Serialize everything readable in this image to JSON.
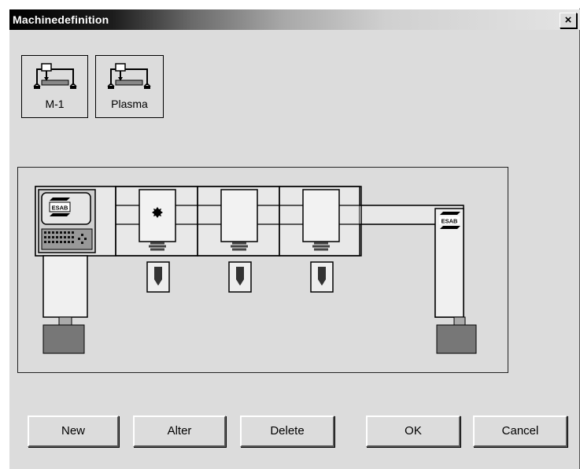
{
  "window": {
    "title": "Machinedefinition",
    "close_glyph": "×"
  },
  "machines": [
    {
      "label": "M-1",
      "icon": "gantry-machine-icon",
      "selected": true
    },
    {
      "label": "Plasma",
      "icon": "gantry-machine-icon",
      "selected": false
    }
  ],
  "diagram": {
    "controller_logo": "ESAB",
    "carriage_logo": "ESAB",
    "stations": [
      "torch-station-1",
      "torch-station-2",
      "torch-station-3"
    ]
  },
  "buttons": {
    "new": "New",
    "alter": "Alter",
    "delete": "Delete",
    "ok": "OK",
    "cancel": "Cancel"
  }
}
